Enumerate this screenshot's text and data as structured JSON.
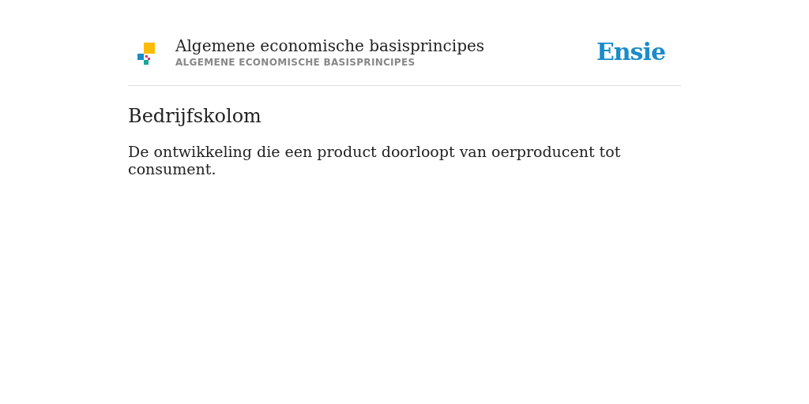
{
  "header": {
    "title": "Algemene economische basisprincipes",
    "subtitle": "ALGEMENE ECONOMISCHE BASISPRINCIPES",
    "brand": "Ensie"
  },
  "term": "Bedrijfskolom",
  "definition": "De ontwikkeling die een product doorloopt van oerproducent tot consument."
}
